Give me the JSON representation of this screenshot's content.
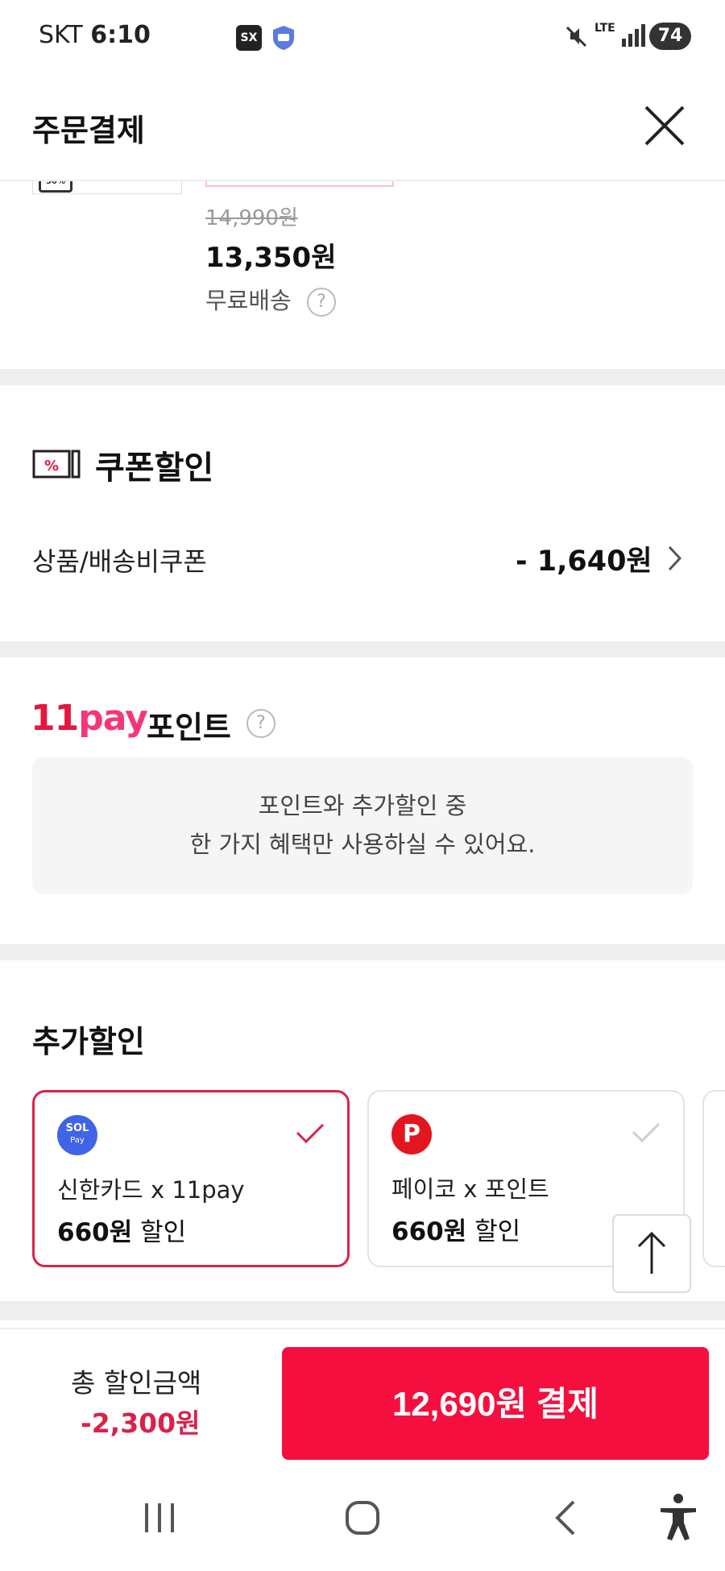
{
  "status_bar": {
    "carrier": "SKT",
    "time": "6:10",
    "network": "LTE",
    "battery": "74"
  },
  "header": {
    "title": "주문결제",
    "close_icon": "close-icon"
  },
  "product": {
    "original_price": "14,990원",
    "sale_price": "13,350원",
    "shipping": "무료배송",
    "help_glyph": "?"
  },
  "coupon": {
    "title": "쿠폰할인",
    "row_label": "상품/배송비쿠폰",
    "row_value": "- 1,640원",
    "icon_glyph": "%"
  },
  "pay_points": {
    "logo_part1": "11",
    "logo_part2": "pay",
    "title": "포인트",
    "help_glyph": "?",
    "notice_line1": "포인트와 추가할인 중",
    "notice_line2": "한 가지 혜택만 사용하실 수 있어요."
  },
  "extra_discount": {
    "title": "추가할인",
    "cards": [
      {
        "name": "신한카드 x 11pay",
        "amount": "660원",
        "suffix": " 할인",
        "logo_text": "SOL",
        "logo_sub": "Pay",
        "selected": true
      },
      {
        "name": "페이코 x 포인트",
        "amount": "660원",
        "suffix": " 할인",
        "logo_text": "P",
        "selected": false
      }
    ]
  },
  "bottom": {
    "total_label": "총 할인금액",
    "total_amount": "-2,300원",
    "pay_button": "12,690원 결제"
  },
  "colors": {
    "accent": "#f40f3f",
    "discount_text": "#d9224a",
    "selected_border": "#d9224a"
  }
}
